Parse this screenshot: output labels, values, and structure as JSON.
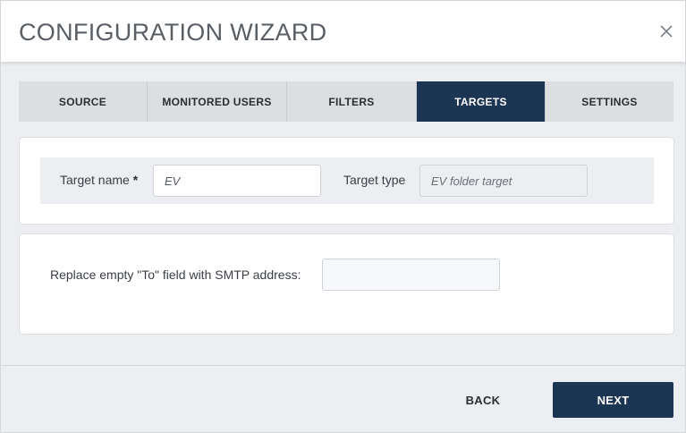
{
  "dialog": {
    "title": "CONFIGURATION WIZARD",
    "close_icon": "close-icon"
  },
  "tabs": [
    {
      "label": "SOURCE",
      "active": false
    },
    {
      "label": "MONITORED USERS",
      "active": false
    },
    {
      "label": "FILTERS",
      "active": false
    },
    {
      "label": "TARGETS",
      "active": true
    },
    {
      "label": "SETTINGS",
      "active": false
    }
  ],
  "target": {
    "name_label": "Target name",
    "required_mark": "*",
    "name_value": "EV",
    "type_label": "Target type",
    "type_value": "EV folder target"
  },
  "smtp": {
    "label": "Replace empty \"To\" field with SMTP address:",
    "value": ""
  },
  "footer": {
    "back_label": "BACK",
    "next_label": "NEXT"
  },
  "colors": {
    "accent": "#1c3553",
    "tab_inactive": "#dcdee1",
    "panel_bg": "#eceef1"
  }
}
